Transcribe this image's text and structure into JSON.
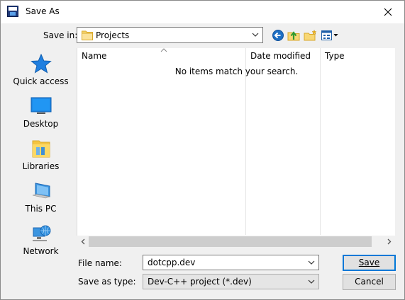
{
  "window": {
    "title": "Save As"
  },
  "header": {
    "save_in_label": "Save in:",
    "save_in_mnemonic": "i",
    "save_in_value": "Projects"
  },
  "places": [
    {
      "id": "quick-access",
      "label": "Quick access",
      "icon": "star-icon"
    },
    {
      "id": "desktop",
      "label": "Desktop",
      "icon": "monitor-icon"
    },
    {
      "id": "libraries",
      "label": "Libraries",
      "icon": "folder-library-icon"
    },
    {
      "id": "this-pc",
      "label": "This PC",
      "icon": "computer-icon"
    },
    {
      "id": "network",
      "label": "Network",
      "icon": "network-icon"
    }
  ],
  "list": {
    "columns": [
      "Name",
      "Date modified",
      "Type"
    ],
    "empty_message": "No items match your search."
  },
  "footer": {
    "file_name_label": "File name:",
    "file_name_value": "dotcpp.dev",
    "save_type_label": "Save as type:",
    "save_type_value": "Dev-C++ project (*.dev)",
    "save_button": "Save",
    "cancel_button": "Cancel"
  },
  "colors": {
    "accent": "#0078d7",
    "folder": "#f5c542",
    "toolbar_back": "#1e6fc4"
  }
}
